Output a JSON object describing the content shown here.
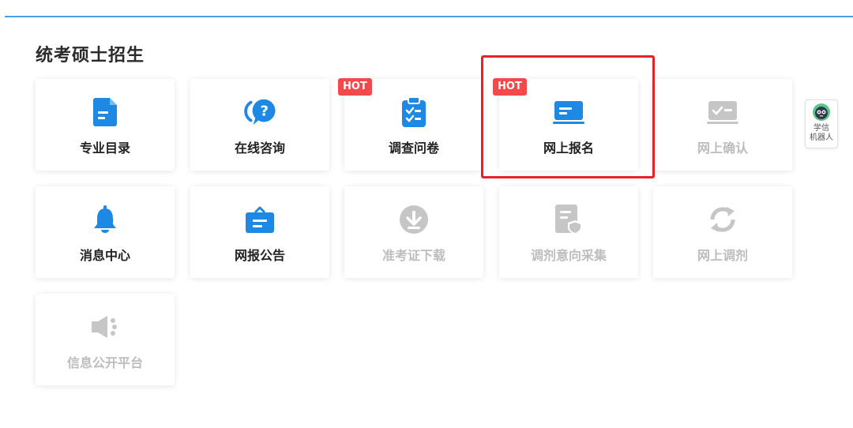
{
  "section": {
    "title": "统考硕士招生"
  },
  "colors": {
    "accent": "#1e88e5",
    "disabled": "#c6c6c6",
    "hot": "#f2494b",
    "highlight": "#e8202a",
    "divider": "#4a9fea"
  },
  "tiles": [
    {
      "label": "专业目录",
      "icon": "document-icon",
      "enabled": true,
      "hot": false
    },
    {
      "label": "在线咨询",
      "icon": "question-chat-icon",
      "enabled": true,
      "hot": false
    },
    {
      "label": "调查问卷",
      "icon": "clipboard-checklist-icon",
      "enabled": true,
      "hot": true
    },
    {
      "label": "网上报名",
      "icon": "id-card-icon",
      "enabled": true,
      "hot": true,
      "highlighted": true
    },
    {
      "label": "网上确认",
      "icon": "verified-card-icon",
      "enabled": false,
      "hot": false
    },
    {
      "label": "消息中心",
      "icon": "bell-icon",
      "enabled": true,
      "hot": false
    },
    {
      "label": "网报公告",
      "icon": "briefcase-icon",
      "enabled": true,
      "hot": false
    },
    {
      "label": "准考证下载",
      "icon": "download-icon",
      "enabled": false,
      "hot": false
    },
    {
      "label": "调剂意向采集",
      "icon": "document-shield-icon",
      "enabled": false,
      "hot": false
    },
    {
      "label": "网上调剂",
      "icon": "refresh-icon",
      "enabled": false,
      "hot": false
    },
    {
      "label": "信息公开平台",
      "icon": "speaker-icon",
      "enabled": false,
      "hot": false
    }
  ],
  "hot_badge": "HOT",
  "robot": {
    "line1": "学信",
    "line2": "机器人",
    "icon": "robot-avatar-icon"
  }
}
